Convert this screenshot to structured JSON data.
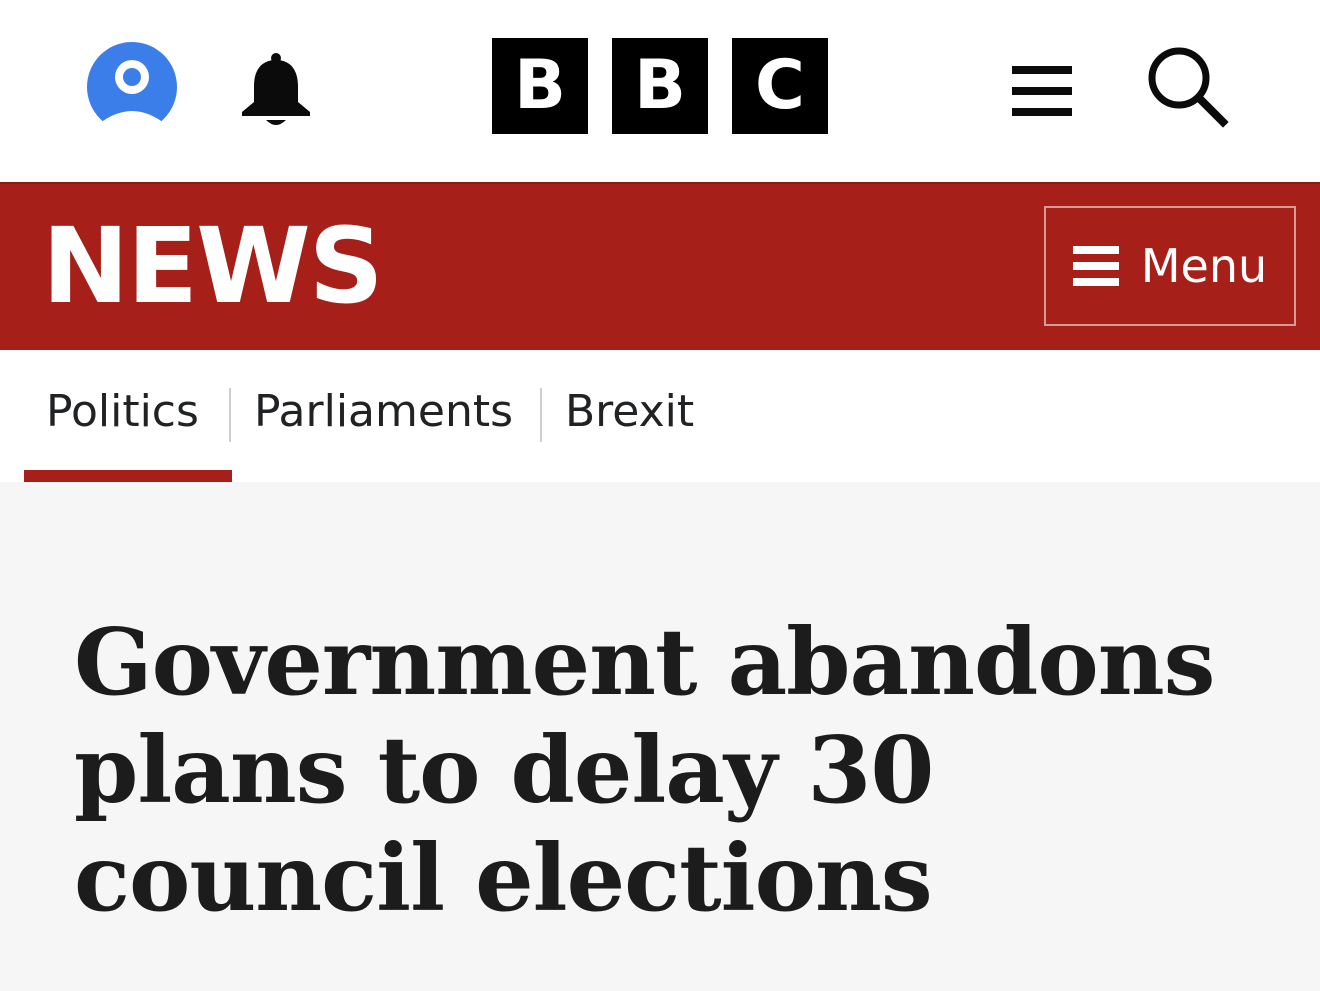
{
  "header": {
    "logo_letters": [
      "B",
      "B",
      "C"
    ],
    "icons": {
      "account": "account-icon",
      "notifications": "bell-icon",
      "menu": "hamburger-icon",
      "search": "search-icon"
    },
    "account_color": "#3b7de9"
  },
  "news_bar": {
    "wordmark": "NEWS",
    "menu_label": "Menu",
    "background_color": "#a62019"
  },
  "section_nav": {
    "items": [
      {
        "label": "Politics",
        "active": true
      },
      {
        "label": "Parliaments",
        "active": false
      },
      {
        "label": "Brexit",
        "active": false
      }
    ]
  },
  "article": {
    "headline": "Government abandons plans to delay 30 council elections"
  }
}
